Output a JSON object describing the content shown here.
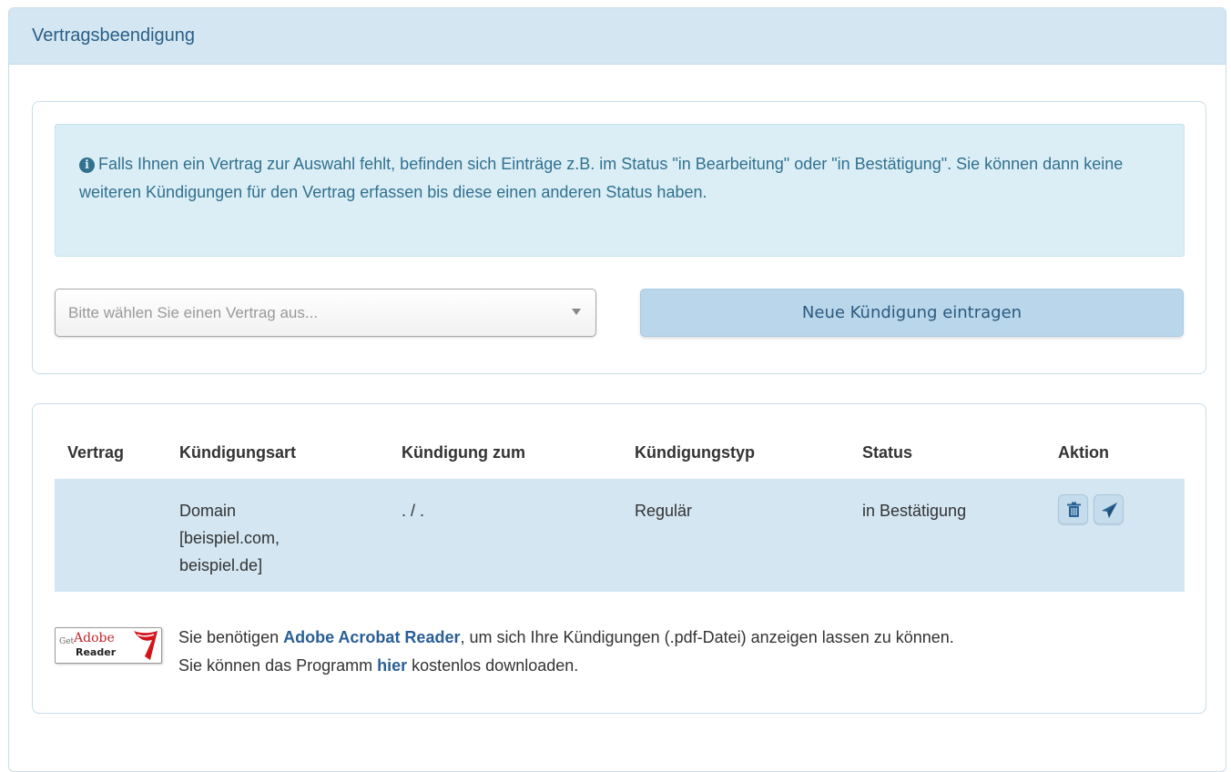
{
  "panel": {
    "title": "Vertragsbeendigung"
  },
  "info_alert": {
    "icon": "info-circle-icon",
    "text": "Falls Ihnen ein Vertrag zur Auswahl fehlt, befinden sich Einträge z.B. im Status \"in Bearbeitung\" oder \"in Bestätigung\". Sie können dann keine weiteren Kündigungen für den Vertrag erfassen bis diese einen anderen Status haben."
  },
  "contract_select": {
    "placeholder": "Bitte wählen Sie einen Vertrag aus...",
    "icon": "caret-down-icon"
  },
  "new_termination_button": {
    "label": "Neue Kündigung eintragen"
  },
  "table": {
    "headers": [
      "Vertrag",
      "Kündigungsart",
      "Kündigung zum",
      "Kündigungstyp",
      "Status",
      "Aktion"
    ],
    "rows": [
      {
        "vertrag": "",
        "art": [
          "Domain",
          "[beispiel.com,",
          "beispiel.de]"
        ],
        "zum": ". / .",
        "typ": "Regulär",
        "status": "in Bestätigung",
        "actions": [
          "trash-icon",
          "send-icon"
        ]
      }
    ]
  },
  "adobe_notice": {
    "badge": {
      "get": "Get",
      "brand": "Adobe",
      "product": "Reader"
    },
    "line1_before": "Sie benötigen ",
    "line1_link": "Adobe Acrobat Reader",
    "line1_after": ", um sich Ihre Kündigungen (.pdf-Datei) anzeigen lassen zu können.",
    "line2_before": "Sie können das Programm ",
    "line2_link": "hier",
    "line2_after": " kostenlos downloaden."
  },
  "colors": {
    "panel_heading_bg": "#d3e6f2",
    "alert_bg": "#dbeef5",
    "alert_text": "#31708f",
    "row_bg": "#d3e6f2",
    "link": "#2a5e96"
  }
}
